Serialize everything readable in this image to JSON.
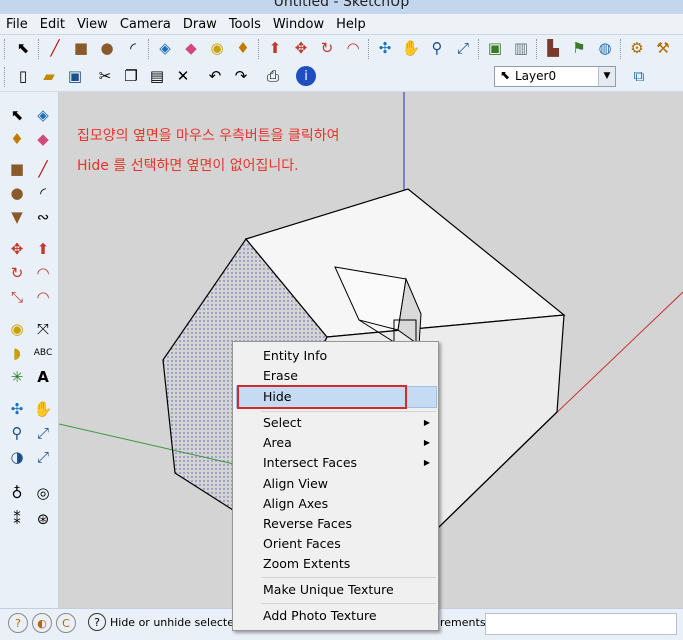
{
  "window": {
    "title": "Untitled - SketchUp"
  },
  "menu": [
    "File",
    "Edit",
    "View",
    "Camera",
    "Draw",
    "Tools",
    "Window",
    "Help"
  ],
  "layer": {
    "current": "Layer0"
  },
  "viewport": {
    "note_line1": "집모양의 옆면을 마우스 우측버튼을 클릭하여",
    "note_line2": "Hide 를 선택하면 옆면이 없어집니다."
  },
  "context_menu": {
    "entity_info": "Entity Info",
    "erase": "Erase",
    "hide": "Hide",
    "select": "Select",
    "area": "Area",
    "intersect_faces": "Intersect Faces",
    "align_view": "Align View",
    "align_axes": "Align Axes",
    "reverse_faces": "Reverse Faces",
    "orient_faces": "Orient Faces",
    "zoom_extents": "Zoom Extents",
    "make_unique_texture": "Make Unique Texture",
    "add_photo_texture": "Add Photo Texture"
  },
  "status": {
    "message": "Hide or unhide selected",
    "measurements": "rements"
  },
  "icons": {
    "geo_location": "geo-location-icon",
    "credits": "credits-icon",
    "copyright": "copyright-icon",
    "help": "help-icon"
  }
}
